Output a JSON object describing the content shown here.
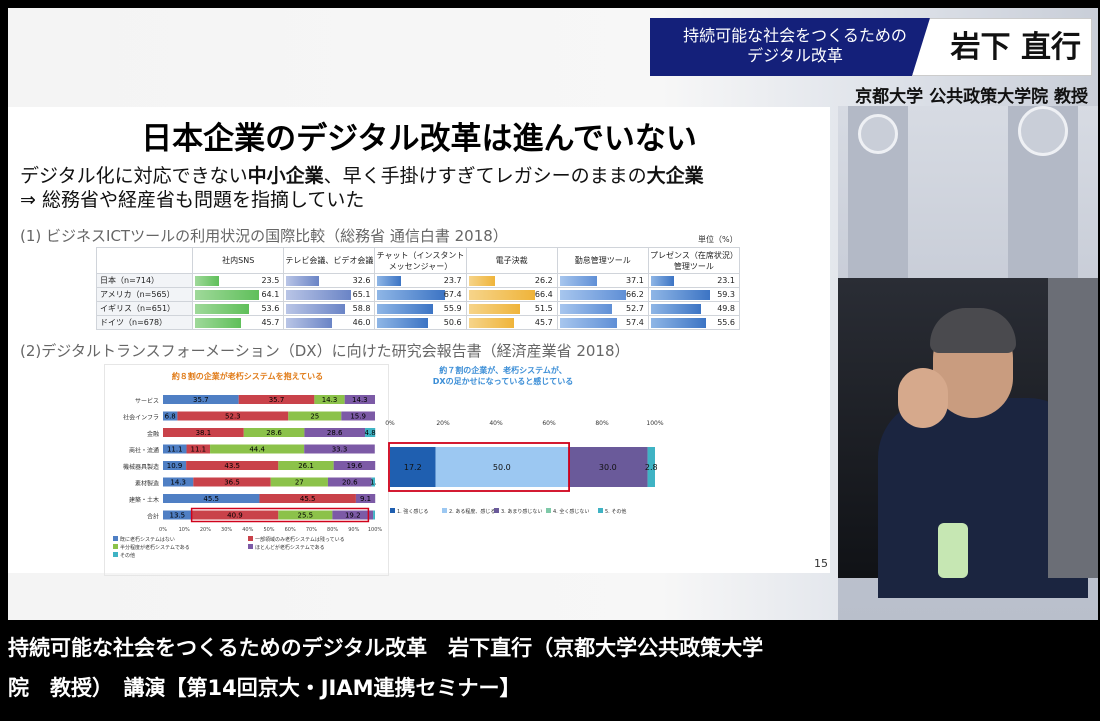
{
  "banner": {
    "subtitle_line1": "持続可能な社会をつくるための",
    "subtitle_line2": "デジタル改革",
    "speaker_name": "岩下 直行",
    "affiliation": "京都大学 公共政策大学院 教授"
  },
  "slide": {
    "title": "日本企業のデジタル改革は進んでいない",
    "line1_a": "デジタル化に対応できない",
    "line1_b": "中小企業",
    "line1_c": "、早く手掛けすぎてレガシーのままの",
    "line1_d": "大企業",
    "line2": "⇒ 総務省や経産省も問題を指摘していた",
    "section1": "(1) ビジネスICTツールの利用状況の国際比較（総務省 通信白書 2018）",
    "unit": "単位（%）",
    "section2": "(2)デジタルトランスフォーメーション（DX）に向けた研究会報告書（経済産業省 2018）",
    "page_number": "15",
    "table": {
      "headers": [
        "社内SNS",
        "テレビ会議、ビデオ会議",
        "チャット（インスタントメッセンジャー）",
        "電子決裁",
        "勤怠管理ツール",
        "プレゼンス（在席状況）管理ツール"
      ],
      "rows": [
        {
          "label": "日本（n=714）",
          "values": [
            23.5,
            32.6,
            23.7,
            26.2,
            37.1,
            23.1
          ]
        },
        {
          "label": "アメリカ（n=565）",
          "values": [
            64.1,
            65.1,
            67.4,
            66.4,
            66.2,
            59.3
          ]
        },
        {
          "label": "イギリス（n=651）",
          "values": [
            53.6,
            58.8,
            55.9,
            51.5,
            52.7,
            49.8
          ]
        },
        {
          "label": "ドイツ（n=678）",
          "values": [
            45.7,
            46.0,
            50.6,
            45.7,
            57.4,
            55.6
          ]
        }
      ],
      "value_labels": [
        [
          "23.5",
          "32.6",
          "23.7",
          "26.2",
          "37.1",
          "23.1"
        ],
        [
          "64.1",
          "65.1",
          "67.4",
          "66.4",
          "66.2",
          "59.3"
        ],
        [
          "53.6",
          "58.8",
          "55.9",
          "51.5",
          "52.7",
          "49.8"
        ],
        [
          "45.7",
          "46.0",
          "50.6",
          "45.7",
          "57.4",
          "55.6"
        ]
      ]
    },
    "chart1_title": "約８割の企業が老朽システムを抱えている",
    "chart2_title_line1": "約７割の企業が、老朽システムが、",
    "chart2_title_line2": "DXの足かせになっていると感じている"
  },
  "chart_data": [
    {
      "type": "bar",
      "orientation": "horizontal-stacked",
      "title": "約８割の企業が老朽システムを抱えている",
      "categories": [
        "サービス",
        "社会インフラ",
        "金融",
        "商社・流通",
        "機械器具製造",
        "素材製造",
        "建築・土木",
        "合計"
      ],
      "series": [
        {
          "name": "既に老朽システムはない",
          "color": "#4f7fc4",
          "values": [
            35.7,
            6.8,
            0,
            11.1,
            10.9,
            14.3,
            45.5,
            13.5
          ]
        },
        {
          "name": "一部領域のみ老朽システムは残っている",
          "color": "#c9424a",
          "values": [
            35.7,
            52.3,
            38.1,
            11.1,
            43.5,
            36.5,
            45.5,
            40.9
          ]
        },
        {
          "name": "半分程度が老朽システムである",
          "color": "#8cc24a",
          "values": [
            14.3,
            25,
            28.6,
            44.4,
            26.1,
            27,
            0,
            25.5
          ]
        },
        {
          "name": "ほとんどが老朽システムである",
          "color": "#7c5aa6",
          "values": [
            14.3,
            15.9,
            28.6,
            33.3,
            19.6,
            20.6,
            9.1,
            19.2
          ]
        },
        {
          "name": "その他",
          "color": "#3fb3c4",
          "values": [
            0,
            0,
            4.8,
            0,
            0,
            1.6,
            0,
            0.9
          ]
        }
      ],
      "labels": [
        [
          "35.7",
          "35.7",
          "14.3",
          "14.3",
          ""
        ],
        [
          "6.8",
          "52.3",
          "25",
          "15.9",
          ""
        ],
        [
          "",
          "38.1",
          "28.6",
          "28.6",
          "4.8"
        ],
        [
          "11.1",
          "11.1",
          "44.4",
          "33.3",
          ""
        ],
        [
          "10.9",
          "43.5",
          "26.1",
          "19.6",
          ""
        ],
        [
          "14.3",
          "36.5",
          "27",
          "20.6",
          "1."
        ],
        [
          "45.5",
          "45.5",
          "",
          "9.1",
          ""
        ],
        [
          "13.5",
          "40.9",
          "25.5",
          "19.2",
          ""
        ]
      ],
      "xticks": [
        "0%",
        "10%",
        "20%",
        "30%",
        "40%",
        "50%",
        "60%",
        "70%",
        "80%",
        "90%",
        "100%"
      ],
      "xlim": [
        0,
        100
      ]
    },
    {
      "type": "bar",
      "orientation": "horizontal-stacked",
      "title": "約７割の企業が、老朽システムが、DXの足かせになっていると感じている",
      "categories": [
        ""
      ],
      "series": [
        {
          "name": "1. 強く感じる",
          "color": "#1f5fb0",
          "values": [
            17.2
          ]
        },
        {
          "name": "2. ある程度、感じる",
          "color": "#9cc8f2",
          "values": [
            50.0
          ]
        },
        {
          "name": "3. あまり感じない",
          "color": "#6a5a9a",
          "values": [
            30.0
          ]
        },
        {
          "name": "4. 全く感じない",
          "color": "#7fc9a8",
          "values": [
            0
          ]
        },
        {
          "name": "5. その他",
          "color": "#3fb3c4",
          "values": [
            2.8
          ]
        }
      ],
      "labels": [
        "17.2",
        "50.0",
        "30.0",
        "",
        "2.8"
      ],
      "xticks": [
        "0%",
        "20%",
        "40%",
        "60%",
        "80%",
        "100%"
      ],
      "xlim": [
        0,
        100
      ]
    }
  ],
  "caption": {
    "line1": "持続可能な社会をつくるためのデジタル改革　岩下直行（京都大学公共政策大学",
    "line2": "院　教授）　講演【第14回京大・JIAM連携セミナー】"
  }
}
